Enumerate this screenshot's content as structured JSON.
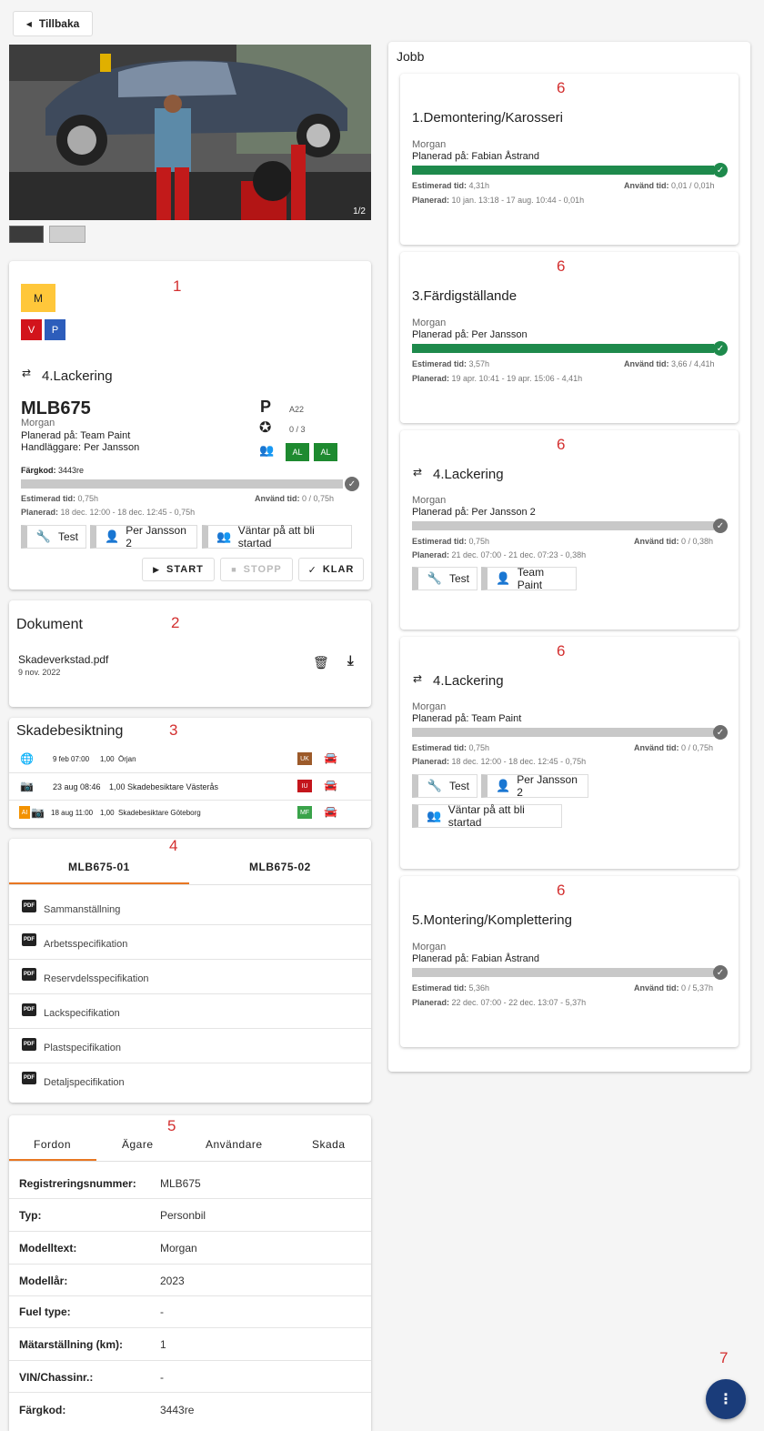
{
  "back_button": "Tillbaka",
  "image_counter": "1/2",
  "section_numbers": [
    "1",
    "2",
    "3",
    "4",
    "5",
    "6",
    "7"
  ],
  "vehicle_card": {
    "badge_m": "M",
    "badge_v": "V",
    "badge_p": "P",
    "job_title": "4.Lackering",
    "reg": "MLB675",
    "model": "Morgan",
    "planned_on": "Planerad på: Team Paint",
    "handler": "Handläggare: Per Jansson",
    "parking_label": "P",
    "parking_value": "A22",
    "parts_value": "0 / 3",
    "al1": "AL",
    "al2": "AL",
    "color_code_label": "Färgkod:",
    "color_code_value": "3443re",
    "est_label": "Estimerad tid:",
    "est_value": "0,75h",
    "used_label": "Använd tid:",
    "used_value": "0 / 0,75h",
    "planned_label": "Planerad:",
    "planned_value": "18 dec. 12:00 - 18 dec. 12:45 - 0,75h",
    "tag_test": "Test",
    "tag_person": "Per Jansson 2",
    "tag_status": "Väntar på att bli startad",
    "start": "START",
    "stop": "STOPP",
    "done": "KLAR"
  },
  "documents": {
    "title": "Dokument",
    "file_name": "Skadeverkstad.pdf",
    "file_date": "9 nov. 2022"
  },
  "inspection": {
    "title": "Skadebesiktning",
    "rows": [
      {
        "date": "9 feb 07:00",
        "value": "1,00",
        "name": "Örjan",
        "badge": "UK",
        "badge_color": "#9c5a2a"
      },
      {
        "date": "23 aug 08:46",
        "value": "1,00",
        "name": "Skadebesiktare Västerås",
        "badge": "IU",
        "badge_color": "#c4161c"
      },
      {
        "date": "18 aug 11:00",
        "value": "1,00",
        "name": "Skadebesiktare Göteborg",
        "badge": "MF",
        "badge_color": "#3aa34a"
      }
    ],
    "ai_label": "AI"
  },
  "specs": {
    "tabs": [
      "MLB675-01",
      "MLB675-02"
    ],
    "items": [
      "Sammanställning",
      "Arbetsspecifikation",
      "Reservdelsspecifikation",
      "Lackspecifikation",
      "Plastspecifikation",
      "Detaljspecifikation"
    ],
    "pdf": "PDF"
  },
  "vehicle_info": {
    "tabs": [
      "Fordon",
      "Ägare",
      "Användare",
      "Skada"
    ],
    "rows": [
      {
        "k": "Registreringsnummer:",
        "v": "MLB675"
      },
      {
        "k": "Typ:",
        "v": "Personbil"
      },
      {
        "k": "Modelltext:",
        "v": "Morgan"
      },
      {
        "k": "Modellår:",
        "v": "2023"
      },
      {
        "k": "Fuel type:",
        "v": "-"
      },
      {
        "k": "Mätarställning (km):",
        "v": "1"
      },
      {
        "k": "VIN/Chassinr.:",
        "v": "-"
      },
      {
        "k": "Färgkod:",
        "v": "3443re"
      }
    ]
  },
  "jobs": {
    "title": "Jobb",
    "items": [
      {
        "num": "6",
        "title": "1.Demontering/Karosseri",
        "model": "Morgan",
        "planned_on": "Planerad på: Fabian Åstrand",
        "progress": 1.0,
        "est": "4,31h",
        "used": "0,01 / 0,01h",
        "planned": "10 jan. 13:18 - 17 aug. 10:44 - 0,01h"
      },
      {
        "num": "6",
        "title": "3.Färdigställande",
        "model": "Morgan",
        "planned_on": "Planerad på: Per Jansson",
        "progress": 1.0,
        "est": "3,57h",
        "used": "3,66 / 4,41h",
        "planned": "19 apr. 10:41 - 19 apr. 15:06 - 4,41h"
      },
      {
        "num": "6",
        "title": "4.Lackering",
        "model": "Morgan",
        "planned_on": "Planerad på: Per Jansson 2",
        "progress": 0,
        "est": "0,75h",
        "used": "0 / 0,38h",
        "planned": "21 dec. 07:00 - 21 dec. 07:23 - 0,38h",
        "tag1": "Test",
        "tag2": "Team Paint"
      },
      {
        "num": "6",
        "title": "4.Lackering",
        "model": "Morgan",
        "planned_on": "Planerad på: Team Paint",
        "progress": 0,
        "est": "0,75h",
        "used": "0 / 0,75h",
        "planned": "18 dec. 12:00 - 18 dec. 12:45 - 0,75h",
        "tag1": "Test",
        "tag2": "Per Jansson 2",
        "tag3": "Väntar på att bli startad"
      },
      {
        "num": "6",
        "title": "5.Montering/Komplettering",
        "model": "Morgan",
        "planned_on": "Planerad på: Fabian Åstrand",
        "progress": 0,
        "est": "5,36h",
        "used": "0 / 5,37h",
        "planned": "22 dec. 07:00 - 22 dec. 13:07 - 5,37h"
      }
    ],
    "est_label": "Estimerad tid:",
    "used_label": "Använd tid:",
    "planned_label": "Planerad:"
  },
  "fab_number": "7"
}
